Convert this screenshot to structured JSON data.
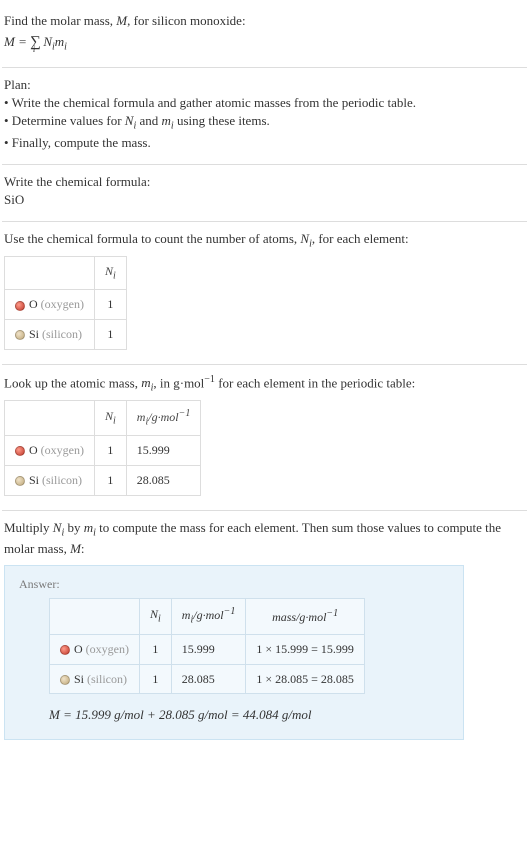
{
  "intro": {
    "line1": "Find the molar mass, ",
    "Mvar": "M",
    "line1b": ", for silicon monoxide:",
    "eq_lhs": "M = ",
    "eq_Ni": "N",
    "eq_mi": "m"
  },
  "plan": {
    "heading": "Plan:",
    "b1": "• Write the chemical formula and gather atomic masses from the periodic table.",
    "b2_a": "• Determine values for ",
    "b2_b": " and ",
    "b2_c": " using these items.",
    "b3": "• Finally, compute the mass."
  },
  "step_formula": {
    "heading": "Write the chemical formula:",
    "value": "SiO"
  },
  "step_count": {
    "heading_a": "Use the chemical formula to count the number of atoms, ",
    "heading_b": ", for each element:",
    "col_Ni": "N",
    "rows": [
      {
        "sym": "O",
        "name": "(oxygen)",
        "n": "1"
      },
      {
        "sym": "Si",
        "name": "(silicon)",
        "n": "1"
      }
    ]
  },
  "step_mass": {
    "heading_a": "Look up the atomic mass, ",
    "heading_b": ", in g·mol",
    "heading_c": " for each element in the periodic table:",
    "col_mi_label": "/g·mol",
    "rows": [
      {
        "sym": "O",
        "name": "(oxygen)",
        "n": "1",
        "m": "15.999"
      },
      {
        "sym": "Si",
        "name": "(silicon)",
        "n": "1",
        "m": "28.085"
      }
    ]
  },
  "step_final": {
    "heading_a": "Multiply ",
    "heading_b": " by ",
    "heading_c": " to compute the mass for each element. Then sum those values to compute the molar mass, ",
    "heading_d": ":",
    "answer_label": "Answer:",
    "col_mass": "mass/g·mol",
    "rows": [
      {
        "sym": "O",
        "name": "(oxygen)",
        "n": "1",
        "m": "15.999",
        "calc": "1 × 15.999 = 15.999"
      },
      {
        "sym": "Si",
        "name": "(silicon)",
        "n": "1",
        "m": "28.085",
        "calc": "1 × 28.085 = 28.085"
      }
    ],
    "result": "M = 15.999 g/mol + 28.085 g/mol = 44.084 g/mol"
  }
}
